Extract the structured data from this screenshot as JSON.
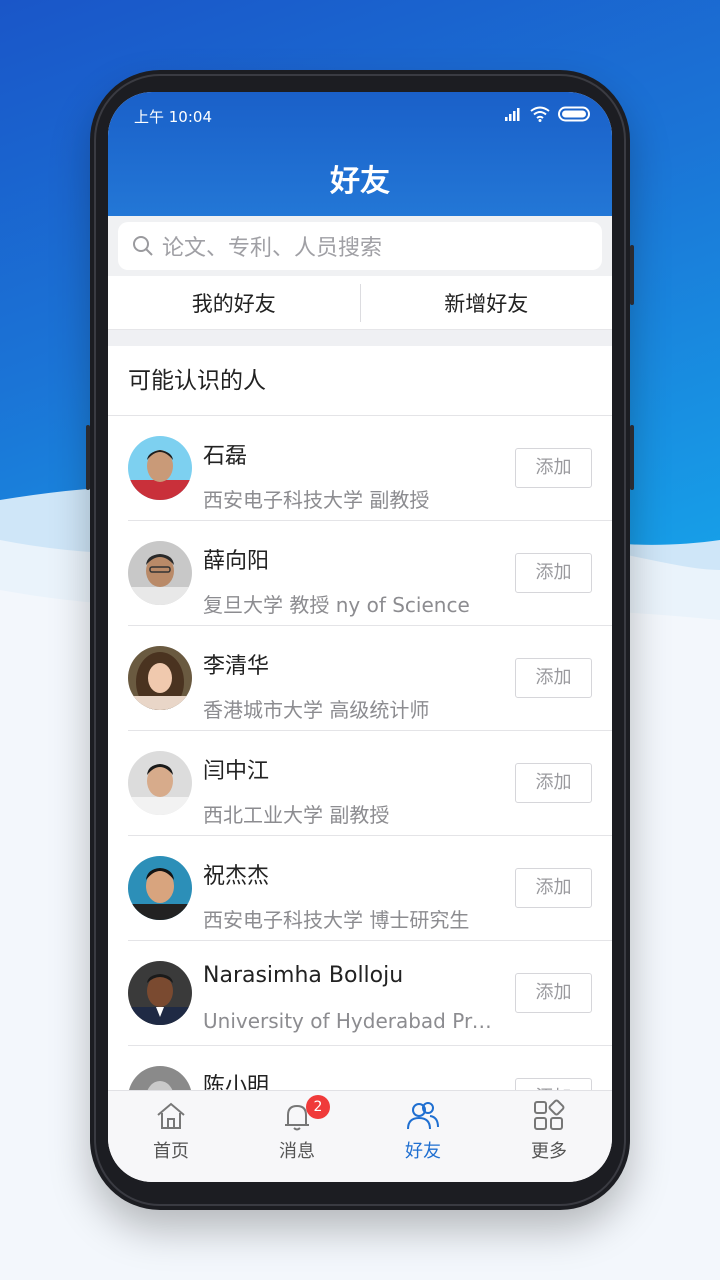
{
  "status_bar": {
    "time": "上午 10:04"
  },
  "header": {
    "title": "好友"
  },
  "search": {
    "placeholder": "论文、专利、人员搜索"
  },
  "tabs": [
    "我的好友",
    "新增好友"
  ],
  "section": {
    "title": "可能认识的人"
  },
  "people": [
    {
      "name": "石磊",
      "desc": "西安电子科技大学 副教授",
      "button": "添加"
    },
    {
      "name": "薛向阳",
      "desc": "复旦大学 教授   ny of Science",
      "button": "添加"
    },
    {
      "name": "李清华",
      "desc": "香港城市大学 高级统计师",
      "button": "添加"
    },
    {
      "name": "闫中江",
      "desc": "西北工业大学 副教授",
      "button": "添加"
    },
    {
      "name": "祝杰杰",
      "desc": "西安电子科技大学 博士研究生",
      "button": "添加"
    },
    {
      "name": "Narasimha Bolloju",
      "desc": "University of Hyderabad Prof…",
      "button": "添加"
    },
    {
      "name": "陈小明",
      "desc": "",
      "button": "添加"
    }
  ],
  "tabbar": {
    "items": [
      {
        "label": "首页",
        "icon": "home-icon"
      },
      {
        "label": "消息",
        "icon": "bell-icon",
        "badge": "2"
      },
      {
        "label": "好友",
        "icon": "friends-icon",
        "active": true
      },
      {
        "label": "更多",
        "icon": "grid-icon"
      }
    ]
  },
  "colors": {
    "accent": "#1f6fd1",
    "header": "#1a60c9",
    "badge": "#f03a3a"
  }
}
